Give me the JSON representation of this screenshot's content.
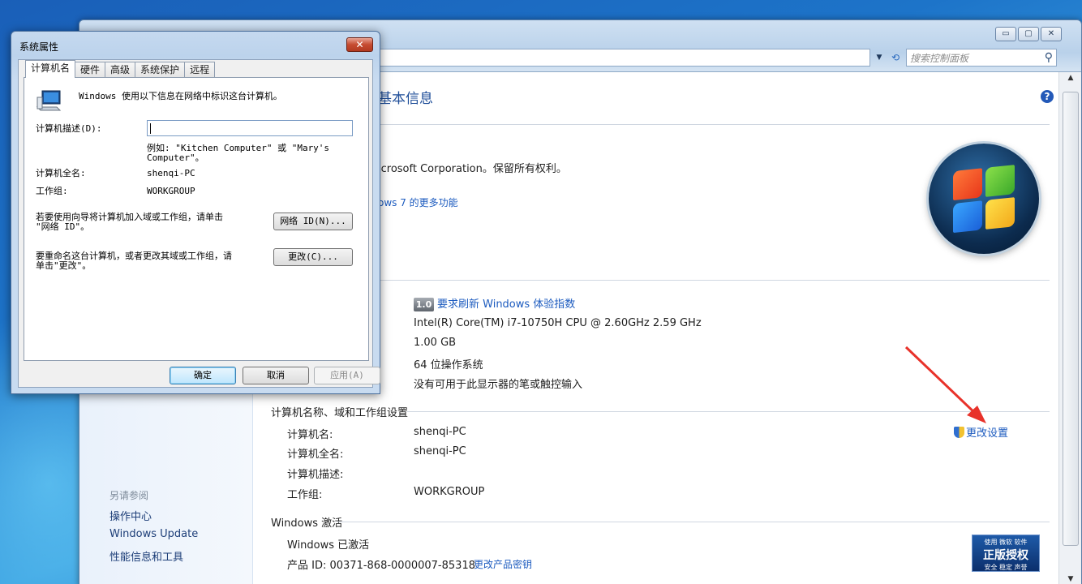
{
  "control_panel": {
    "search_placeholder": "搜索控制面板",
    "title": "基本信息",
    "copyright": "icrosoft Corporation。保留所有权利。",
    "more_features_link": "ows 7 的更多功能",
    "system": {
      "rating_score": "1.0",
      "rating_link": "要求刷新 Windows 体验指数",
      "processor": "Intel(R) Core(TM) i7-10750H CPU @ 2.60GHz   2.59 GHz",
      "memory": "1.00 GB",
      "system_type": "64 位操作系统",
      "pen_touch": "没有可用于此显示器的笔或触控输入"
    },
    "computer_section": {
      "header": "计算机名称、域和工作组设置",
      "computer_name_label": "计算机名:",
      "computer_name": "shenqi-PC",
      "full_name_label": "计算机全名:",
      "full_name": "shenqi-PC",
      "description_label": "计算机描述:",
      "description": "",
      "workgroup_label": "工作组:",
      "workgroup": "WORKGROUP",
      "change_settings": "更改设置"
    },
    "activation": {
      "header": "Windows 激活",
      "status": "Windows 已激活",
      "product_id": "产品 ID: 00371-868-0000007-85318",
      "change_key_link": "更改产品密钥",
      "genuine_badge_line1": "使用 微软 软件",
      "genuine_badge_line2": "正版授权",
      "genuine_badge_line3": "安全 稳定 声誉"
    },
    "nav": {
      "see_also": "另请参阅",
      "items": [
        "操作中心",
        "Windows Update",
        "性能信息和工具"
      ]
    }
  },
  "dialog": {
    "title": "系统属性",
    "tabs": [
      "计算机名",
      "硬件",
      "高级",
      "系统保护",
      "远程"
    ],
    "intro": "Windows 使用以下信息在网络中标识这台计算机。",
    "description_label": "计算机描述(D):",
    "description_value": "",
    "example_line1": "例如: \"Kitchen Computer\" 或 \"Mary's",
    "example_line2": "Computer\"。",
    "full_name_label": "计算机全名:",
    "full_name": "shenqi-PC",
    "workgroup_label": "工作组:",
    "workgroup": "WORKGROUP",
    "network_text_line1": "若要使用向导将计算机加入域或工作组，请单击",
    "network_text_line2": "\"网络 ID\"。",
    "network_button": "网络 ID(N)...",
    "rename_text_line1": "要重命名这台计算机，或者更改其域或工作组，请",
    "rename_text_line2": "单击\"更改\"。",
    "change_button": "更改(C)...",
    "ok_button": "确定",
    "cancel_button": "取消",
    "apply_button": "应用(A)"
  }
}
